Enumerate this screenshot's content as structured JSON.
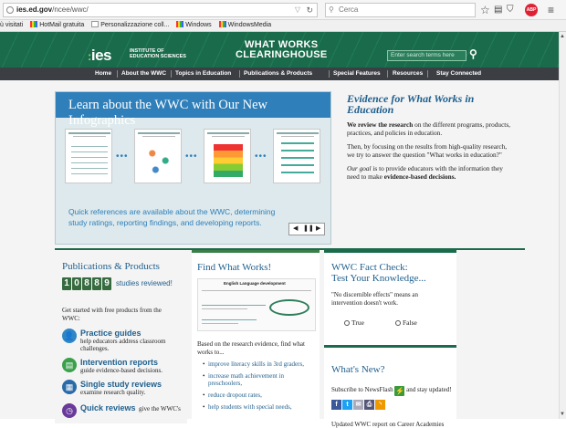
{
  "browser": {
    "url_domain": "ies.ed.gov",
    "url_path": "/ncee/wwc/",
    "search_placeholder": "Cerca",
    "toolbar_icons": [
      "star-icon",
      "reading-list-icon",
      "pocket-icon",
      "download-icon",
      "home-icon",
      "sync-icon",
      "adblock-icon",
      "menu-icon"
    ],
    "adblock_label": "ABP"
  },
  "bookmarks": [
    {
      "label": "ù visitati",
      "icon": "page"
    },
    {
      "label": "HotMail gratuita",
      "icon": "msn"
    },
    {
      "label": "Personalizzazione coll...",
      "icon": "page"
    },
    {
      "label": "Windows",
      "icon": "msn"
    },
    {
      "label": "WindowsMedia",
      "icon": "msn"
    }
  ],
  "header": {
    "logo_text": "ies",
    "logo_sub_line1": "INSTITUTE OF",
    "logo_sub_line2": "EDUCATION SCIENCES",
    "title_line1": "WHAT WORKS",
    "title_line2": "CLEARINGHOUSE",
    "search_placeholder": "Enter search terms here",
    "colors": {
      "brand_green": "#1a6b4b",
      "nav_dark": "#3b3f44",
      "link_blue": "#1f5f8d",
      "hero_blue": "#2f7fba"
    }
  },
  "nav": {
    "items": [
      "Home",
      "About the WWC",
      "Topics in Education",
      "Publications & Products",
      "Special Features",
      "Resources",
      "Stay Connected"
    ]
  },
  "hero": {
    "title": "Learn about the WWC with Our New Infographics",
    "card_titles": [
      "WHAT IS THE WWC?",
      "HOW THE WWC RATES A STUDY",
      "MAKING AN INTERVENTION REPORT",
      "REPORTING WHAT WORKS"
    ],
    "caption": "Quick references are available about the WWC, determining study ratings, reporting findings, and developing reports.",
    "controls": {
      "prev": "◀",
      "pause": "❚❚",
      "next": "▶"
    }
  },
  "evidence": {
    "title": "Evidence for What Works in Education",
    "p1_bold": "We review the research",
    "p1_rest": " on the different programs, products, practices, and policies in education.",
    "p2": "Then, by focusing on the results from high-quality research, we try to answer the question \"What works in education?\"",
    "p3_italic": "Our goal",
    "p3_rest": " is to provide educators with the information they need to make ",
    "p3_bold": "evidence-based decisions."
  },
  "publications": {
    "title": "Publications & Products",
    "counter_digits": [
      "1",
      "0",
      "8",
      "8",
      "9"
    ],
    "counter_label": "studies reviewed!",
    "intro": "Get started with free products from the WWC:",
    "items": [
      {
        "link": "Practice guides",
        "desc": "help educators address classroom challenges.",
        "icon_color": "#2f86c6",
        "icon": "person-icon"
      },
      {
        "link": "Intervention reports",
        "desc": "guide evidence-based decisions.",
        "icon_color": "#3aa04a",
        "icon": "report-icon"
      },
      {
        "link": "Single study reviews",
        "desc": "examine research quality.",
        "icon_color": "#2a6aa8",
        "icon": "document-icon"
      },
      {
        "link": "Quick reviews",
        "desc": "give the WWC's",
        "icon_color": "#6a3a9a",
        "icon": "clock-icon"
      }
    ]
  },
  "find": {
    "title": "Find What Works!",
    "image_caption": "English Language development",
    "intro": "Based on the research evidence, find what works to...",
    "list": [
      "improve literacy skills in 3rd graders,",
      "increase math achievement in preschoolers,",
      "reduce dropout rates,",
      "help students with special needs,"
    ]
  },
  "fact_check": {
    "title_line1": "WWC Fact Check:",
    "title_line2": "Test Your Knowledge...",
    "question": "\"No discernible effects\" means an intervention doesn't work.",
    "options": [
      "True",
      "False"
    ]
  },
  "whats_new": {
    "title": "What's New?",
    "newsflash_pre": "Subscribe to NewsFlash",
    "newsflash_post": "and stay updated!",
    "social_icons": [
      "facebook-icon",
      "twitter-icon",
      "email-icon",
      "print-icon",
      "rss-icon"
    ],
    "update": "Updated WWC report on Career Academies"
  }
}
